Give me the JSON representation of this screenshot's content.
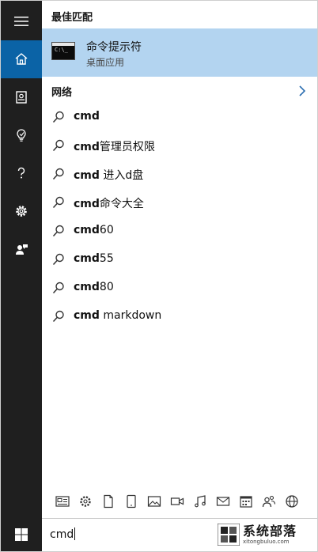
{
  "sidebar": {
    "items": [
      {
        "name": "hamburger-menu-icon"
      },
      {
        "name": "home-icon",
        "active": true
      },
      {
        "name": "notebook-icon"
      },
      {
        "name": "lightbulb-icon"
      },
      {
        "name": "help-icon"
      },
      {
        "name": "settings-gear-icon"
      },
      {
        "name": "feedback-icon"
      }
    ],
    "start": {
      "icon": "windows-logo-icon"
    }
  },
  "best_match": {
    "heading": "最佳匹配",
    "app_name": "命令提示符",
    "app_type": "桌面应用",
    "icon": "command-prompt-icon"
  },
  "web": {
    "heading": "网络",
    "suggestions": [
      {
        "bold": "cmd",
        "rest": ""
      },
      {
        "bold": "cmd",
        "rest": "管理员权限"
      },
      {
        "bold": "cmd",
        "rest": " 进入d盘"
      },
      {
        "bold": "cmd",
        "rest": "命令大全"
      },
      {
        "bold": "cmd",
        "rest": "60"
      },
      {
        "bold": "cmd",
        "rest": "55"
      },
      {
        "bold": "cmd",
        "rest": "80"
      },
      {
        "bold": "cmd",
        "rest": " markdown"
      }
    ]
  },
  "filters": [
    "news-icon",
    "settings-icon",
    "document-icon",
    "tablet-icon",
    "photo-icon",
    "video-icon",
    "music-icon",
    "mail-icon",
    "calendar-icon",
    "people-icon",
    "web-icon"
  ],
  "search": {
    "value": "cmd"
  },
  "watermark": {
    "text": "系统部落",
    "url": "xitongbuluo.com"
  },
  "colors": {
    "sidebar": "#1f1f1f",
    "active": "#0b63a6",
    "highlight": "#b3d4f0"
  }
}
